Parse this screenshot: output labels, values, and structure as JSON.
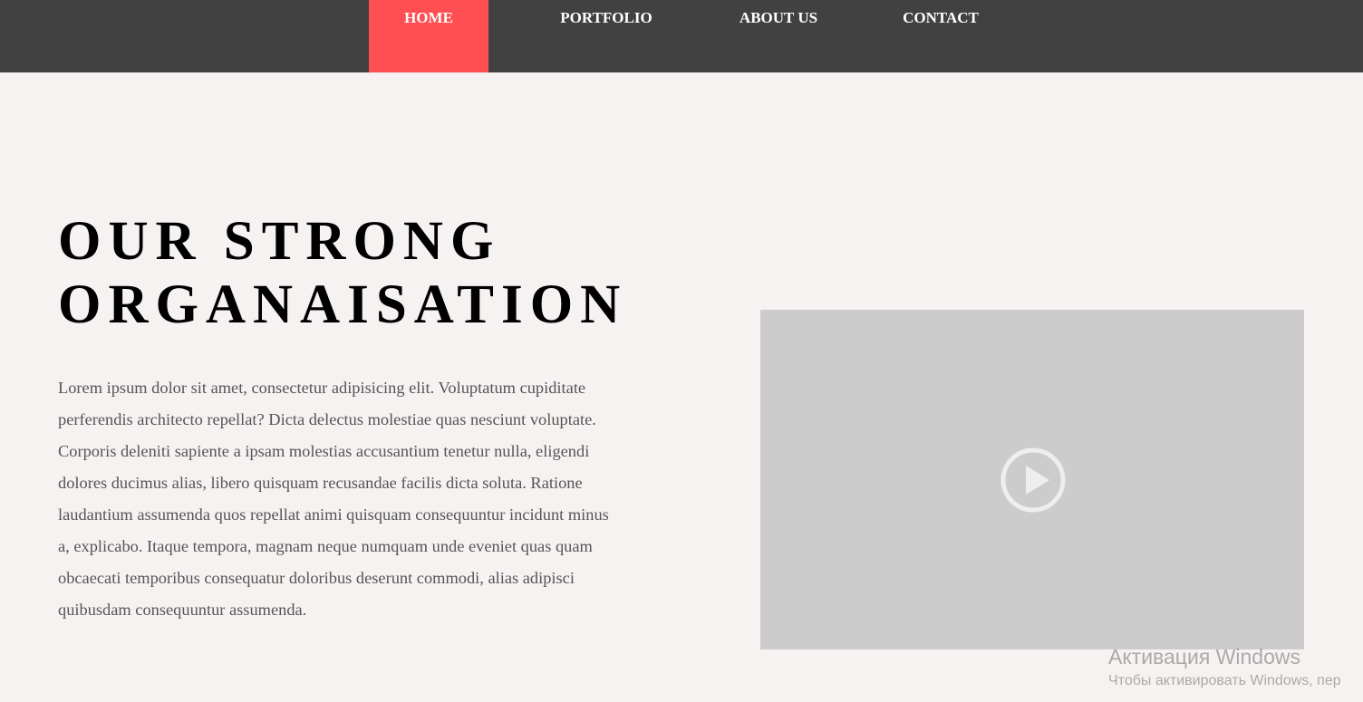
{
  "nav": {
    "items": [
      {
        "label": "HOME",
        "active": true
      },
      {
        "label": "PORTFOLIO",
        "active": false
      },
      {
        "label": "ABOUT US",
        "active": false
      },
      {
        "label": "CONTACT",
        "active": false
      }
    ]
  },
  "hero": {
    "title_line1": "OUR STRONG",
    "title_line2": "ORGANAISATION",
    "body": "Lorem ipsum dolor sit amet, consectetur adipisicing elit. Voluptatum cupiditate perferendis architecto repellat? Dicta delectus molestiae quas nesciunt voluptate. Corporis deleniti sapiente a ipsam molestias accusantium tenetur nulla, eligendi dolores ducimus alias, libero quisquam recusandae facilis dicta soluta. Ratione laudantium assumenda quos repellat animi quisquam consequuntur incidunt minus a, explicabo. Itaque tempora, magnam neque numquam unde eveniet quas quam obcaecati temporibus consequatur doloribus deserunt commodi, alias adipisci quibusdam consequuntur assumenda."
  },
  "video": {
    "icon": "play-icon"
  },
  "watermark": {
    "title": "Активация Windows",
    "subtitle": "Чтобы активировать Windows, пер"
  },
  "colors": {
    "nav_background": "#414141",
    "nav_active": "#ff4f53",
    "page_background": "#f5f2f1",
    "video_placeholder": "#cccccc"
  }
}
